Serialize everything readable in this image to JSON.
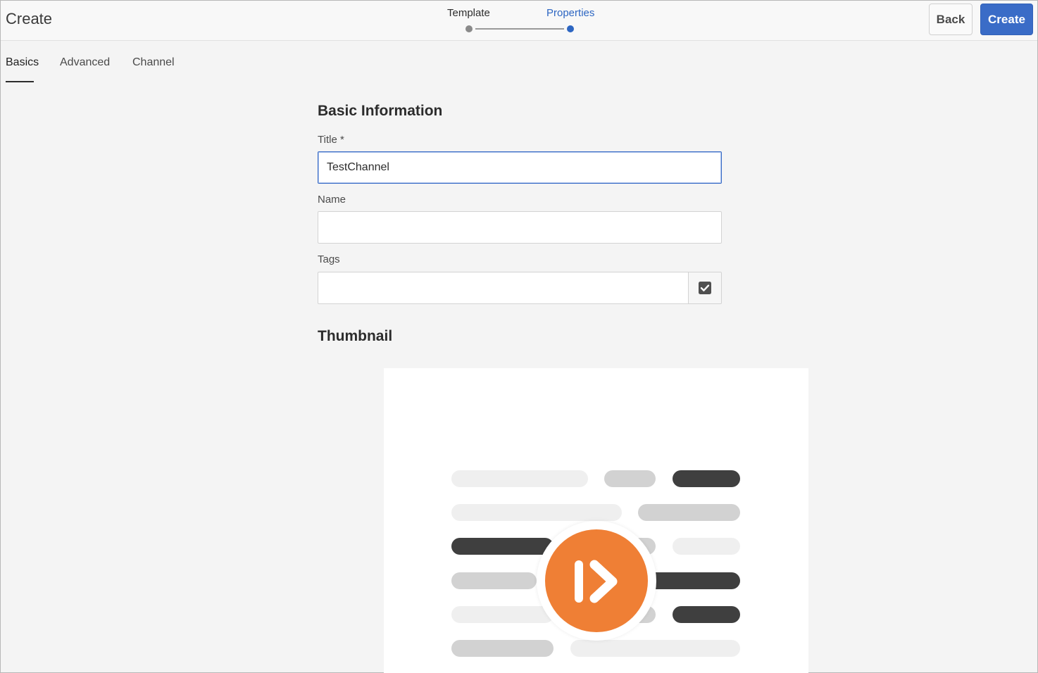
{
  "header": {
    "title": "Create",
    "wizard": {
      "steps": [
        {
          "label": "Template",
          "state": "done"
        },
        {
          "label": "Properties",
          "state": "current"
        }
      ]
    },
    "back_label": "Back",
    "create_label": "Create"
  },
  "tabs": [
    {
      "label": "Basics",
      "active": true
    },
    {
      "label": "Advanced",
      "active": false
    },
    {
      "label": "Channel",
      "active": false
    }
  ],
  "form": {
    "section_title": "Basic Information",
    "title_label": "Title *",
    "title_value": "TestChannel",
    "name_label": "Name",
    "name_value": "",
    "tags_label": "Tags",
    "tags_value": "",
    "tags_picker_icon": "checkbox-checked-icon"
  },
  "thumbnail": {
    "section_title": "Thumbnail",
    "icon": "adobe-screens-play-icon"
  },
  "colors": {
    "accent": "#3a6cc7",
    "step_active": "#2d66c2",
    "thumbnail_orange": "#ef7f35"
  }
}
